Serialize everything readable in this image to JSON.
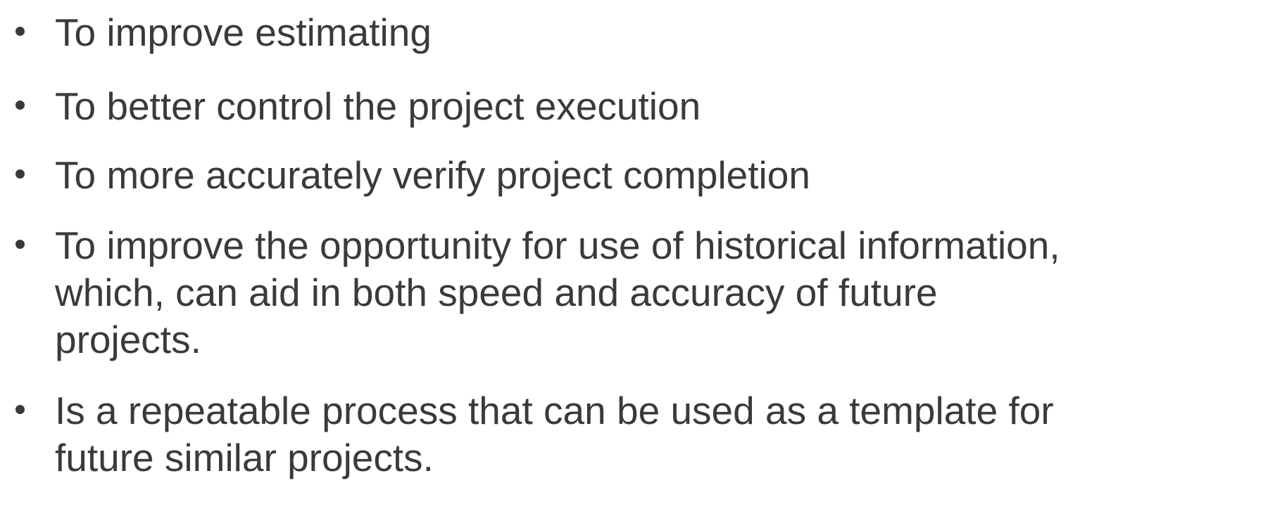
{
  "bullets": [
    {
      "text": "To improve estimating"
    },
    {
      "text": "To better control the project execution"
    },
    {
      "text": "To more accurately verify project completion"
    },
    {
      "text": "To improve the opportunity for use of historical information,\nwhich, can aid in both speed and accuracy of future\nprojects."
    },
    {
      "text": "Is a repeatable process that can be used as a template for\nfuture similar projects."
    }
  ],
  "colors": {
    "text": "#3a3a3a",
    "background": "#ffffff"
  }
}
